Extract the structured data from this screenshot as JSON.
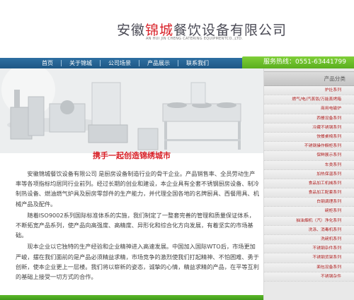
{
  "header": {
    "title_prefix": "安徽",
    "title_highlight": "锦城",
    "title_suffix": "餐饮设备有限公司",
    "subtitle": "AN HUI JIN CHENG CATERING EQUIPMENTCO.,LTD."
  },
  "nav": {
    "items": [
      "首页",
      "关于锦城",
      "公司场景",
      "产品展示",
      "联系我们"
    ]
  },
  "hotline": {
    "label": "服务热线：0551-63441799"
  },
  "main": {
    "slogan": "携手一起创造锦绣城市",
    "paragraphs": [
      "安徽锦城餐饮设备有限公司 是厨房设备制造行业的骨干企业。产品销售率、全员劳动生产率等各项指标均居同行业前列。经过长期的创业和建设，本企业具有全套不锈钢厨房设备、制冷制热设备、燃油燃气炉具及厨房零部件的生产能力，并代理全国各地的名牌厨具、西餐用具、机械产品及配件。",
      "随着ISO9002系列国际标准体系的实施，我们制定了一整套完善的管理和质量保证体系，不断拓宽产品系列，使产品向高强度、高精度、异形化和综合化方向发展，有着坚实的市场基础。",
      "现本企业以它独特的生产经验和企业精神进入高速发展。中国加入国际WTO后，市场更加严峻，摆在我们面前的是产品必须精益求精，市场竞争的激烈使我们打起精神、不怕困难、勇于创新，使本企业更上一层楼。我们将以崭新的姿态，诚挚的心情，精益求精的产品，在平等互利的基础上接受一切方式的合作。"
    ]
  },
  "sidebar": {
    "heading": "产品分类",
    "items": [
      "炉灶系列",
      "燃气/电/汽蒸饭/万能蒸烤箱",
      "商用电磁炉",
      "西餐设备系列",
      "冷藏不锈钢系列",
      "快餐桌椅系列",
      "不锈钢操作橱柜系列",
      "保鲜展示系列",
      "车类系列",
      "加热保温系列",
      "食品加工机械系列",
      "食品加工配套系列",
      "白钢调理系列",
      "碗柜系列",
      "抽油烟机（汽）净化系列",
      "洗涤、消毒机系列",
      "洗碗机系列",
      "不锈钢杂件系列",
      "不锈钢货架系列",
      "面包设备系列",
      "不锈钢杂件"
    ]
  },
  "colors": {
    "nav_blue": "#2e6fa2",
    "accent_green": "#5aae1f",
    "brand_red": "#d81f26"
  }
}
